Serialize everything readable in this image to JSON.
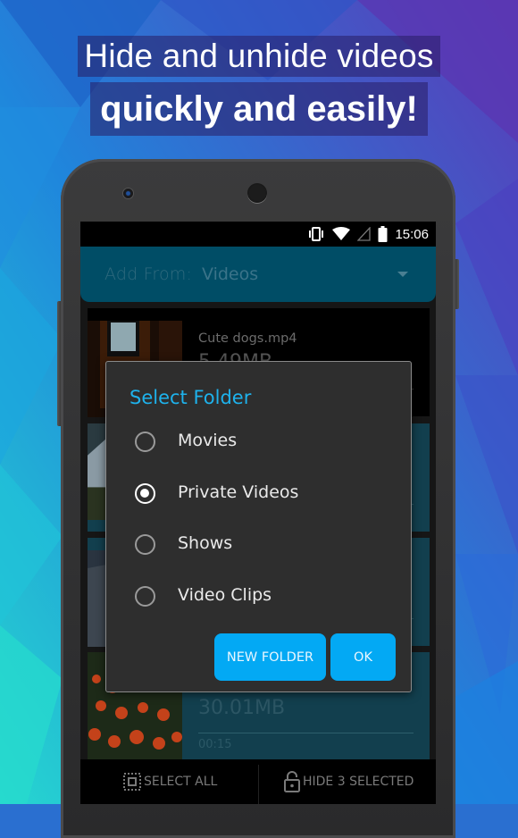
{
  "promo": {
    "line1": "Hide and unhide videos",
    "line2": "quickly and easily!"
  },
  "status_bar": {
    "icons": [
      "vibrate-icon",
      "wifi-icon",
      "cell-signal-icon",
      "battery-icon"
    ],
    "time": "15:06"
  },
  "add_from": {
    "label": "Add From:",
    "value": "Videos"
  },
  "videos": [
    {
      "name": "Cute dogs.mp4",
      "size": "5.49MB",
      "duration": "",
      "selected": false
    },
    {
      "name": "",
      "size": "",
      "duration": "",
      "selected": true
    },
    {
      "name": "",
      "size": "",
      "duration": "",
      "selected": true
    },
    {
      "name": "",
      "size": "30.01MB",
      "duration": "00:15",
      "selected": true
    }
  ],
  "dialog": {
    "title": "Select Folder",
    "options": [
      {
        "label": "Movies",
        "checked": false
      },
      {
        "label": "Private Videos",
        "checked": true
      },
      {
        "label": "Shows",
        "checked": false
      },
      {
        "label": "Video Clips",
        "checked": false
      }
    ],
    "new_folder_label": "NEW FOLDER",
    "ok_label": "OK"
  },
  "bottom_bar": {
    "select_all_label": "SELECT ALL",
    "hide_selected_label": "HIDE 3 SELECTED"
  },
  "colors": {
    "accent": "#03a9f4",
    "dialog_title": "#1eb2ec",
    "dropdown_bg": "#004d66",
    "selected_row_bg": "#123f4e",
    "dialog_bg": "#2e2e2e"
  }
}
